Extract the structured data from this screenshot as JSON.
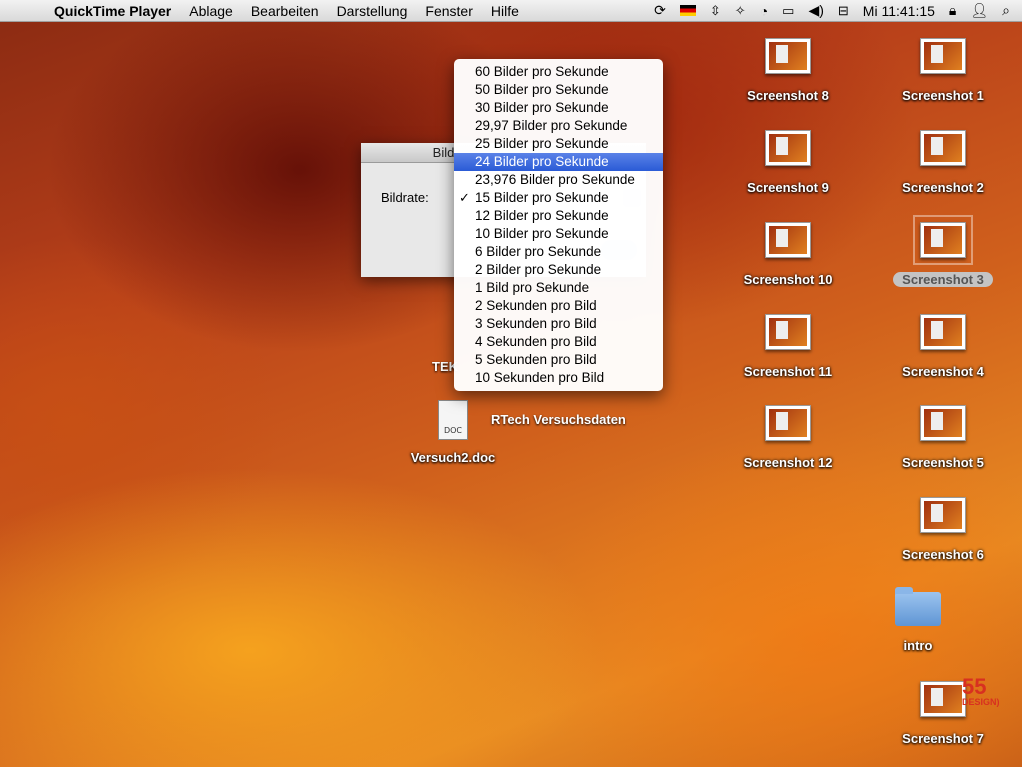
{
  "menubar": {
    "app_name": "QuickTime Player",
    "menus": [
      "Ablage",
      "Bearbeiten",
      "Darstellung",
      "Fenster",
      "Hilfe"
    ],
    "clock": "Mi 11:41:15"
  },
  "dialog": {
    "title_partial": "Bild",
    "field_label": "Bildrate:"
  },
  "framerate_menu": {
    "selected_index": 5,
    "checked_index": 7,
    "items": [
      "60 Bilder pro Sekunde",
      "50 Bilder pro Sekunde",
      "30 Bilder pro Sekunde",
      "29,97 Bilder pro Sekunde",
      "25 Bilder pro Sekunde",
      "24 Bilder pro Sekunde",
      "23,976 Bilder pro Sekunde",
      "15 Bilder pro Sekunde",
      "12 Bilder pro Sekunde",
      "10 Bilder pro Sekunde",
      "6 Bilder pro Sekunde",
      "2 Bilder pro Sekunde",
      "1 Bild pro Sekunde",
      "2 Sekunden pro Bild",
      "3 Sekunden pro Bild",
      "4 Sekunden pro Bild",
      "5 Sekunden pro Bild",
      "10 Sekunden pro Bild"
    ]
  },
  "desktop": {
    "screenshots": {
      "s8": "Screenshot 8",
      "s1": "Screenshot 1",
      "s9": "Screenshot 9",
      "s2": "Screenshot 2",
      "s10": "Screenshot 10",
      "s3": "Screenshot 3",
      "s11": "Screenshot 11",
      "s4": "Screenshot 4",
      "s12": "Screenshot 12",
      "s5": "Screenshot 5",
      "s6": "Screenshot 6",
      "s7": "Screenshot 7"
    },
    "folder_intro": "intro",
    "doc_file": "Versuch2.doc",
    "doc_badge": "DOC",
    "rtech_folder": "RTech Versuchsdaten",
    "partial_tek": "TEK"
  },
  "watermark": {
    "big": "55",
    "small": "DESIGN)"
  }
}
